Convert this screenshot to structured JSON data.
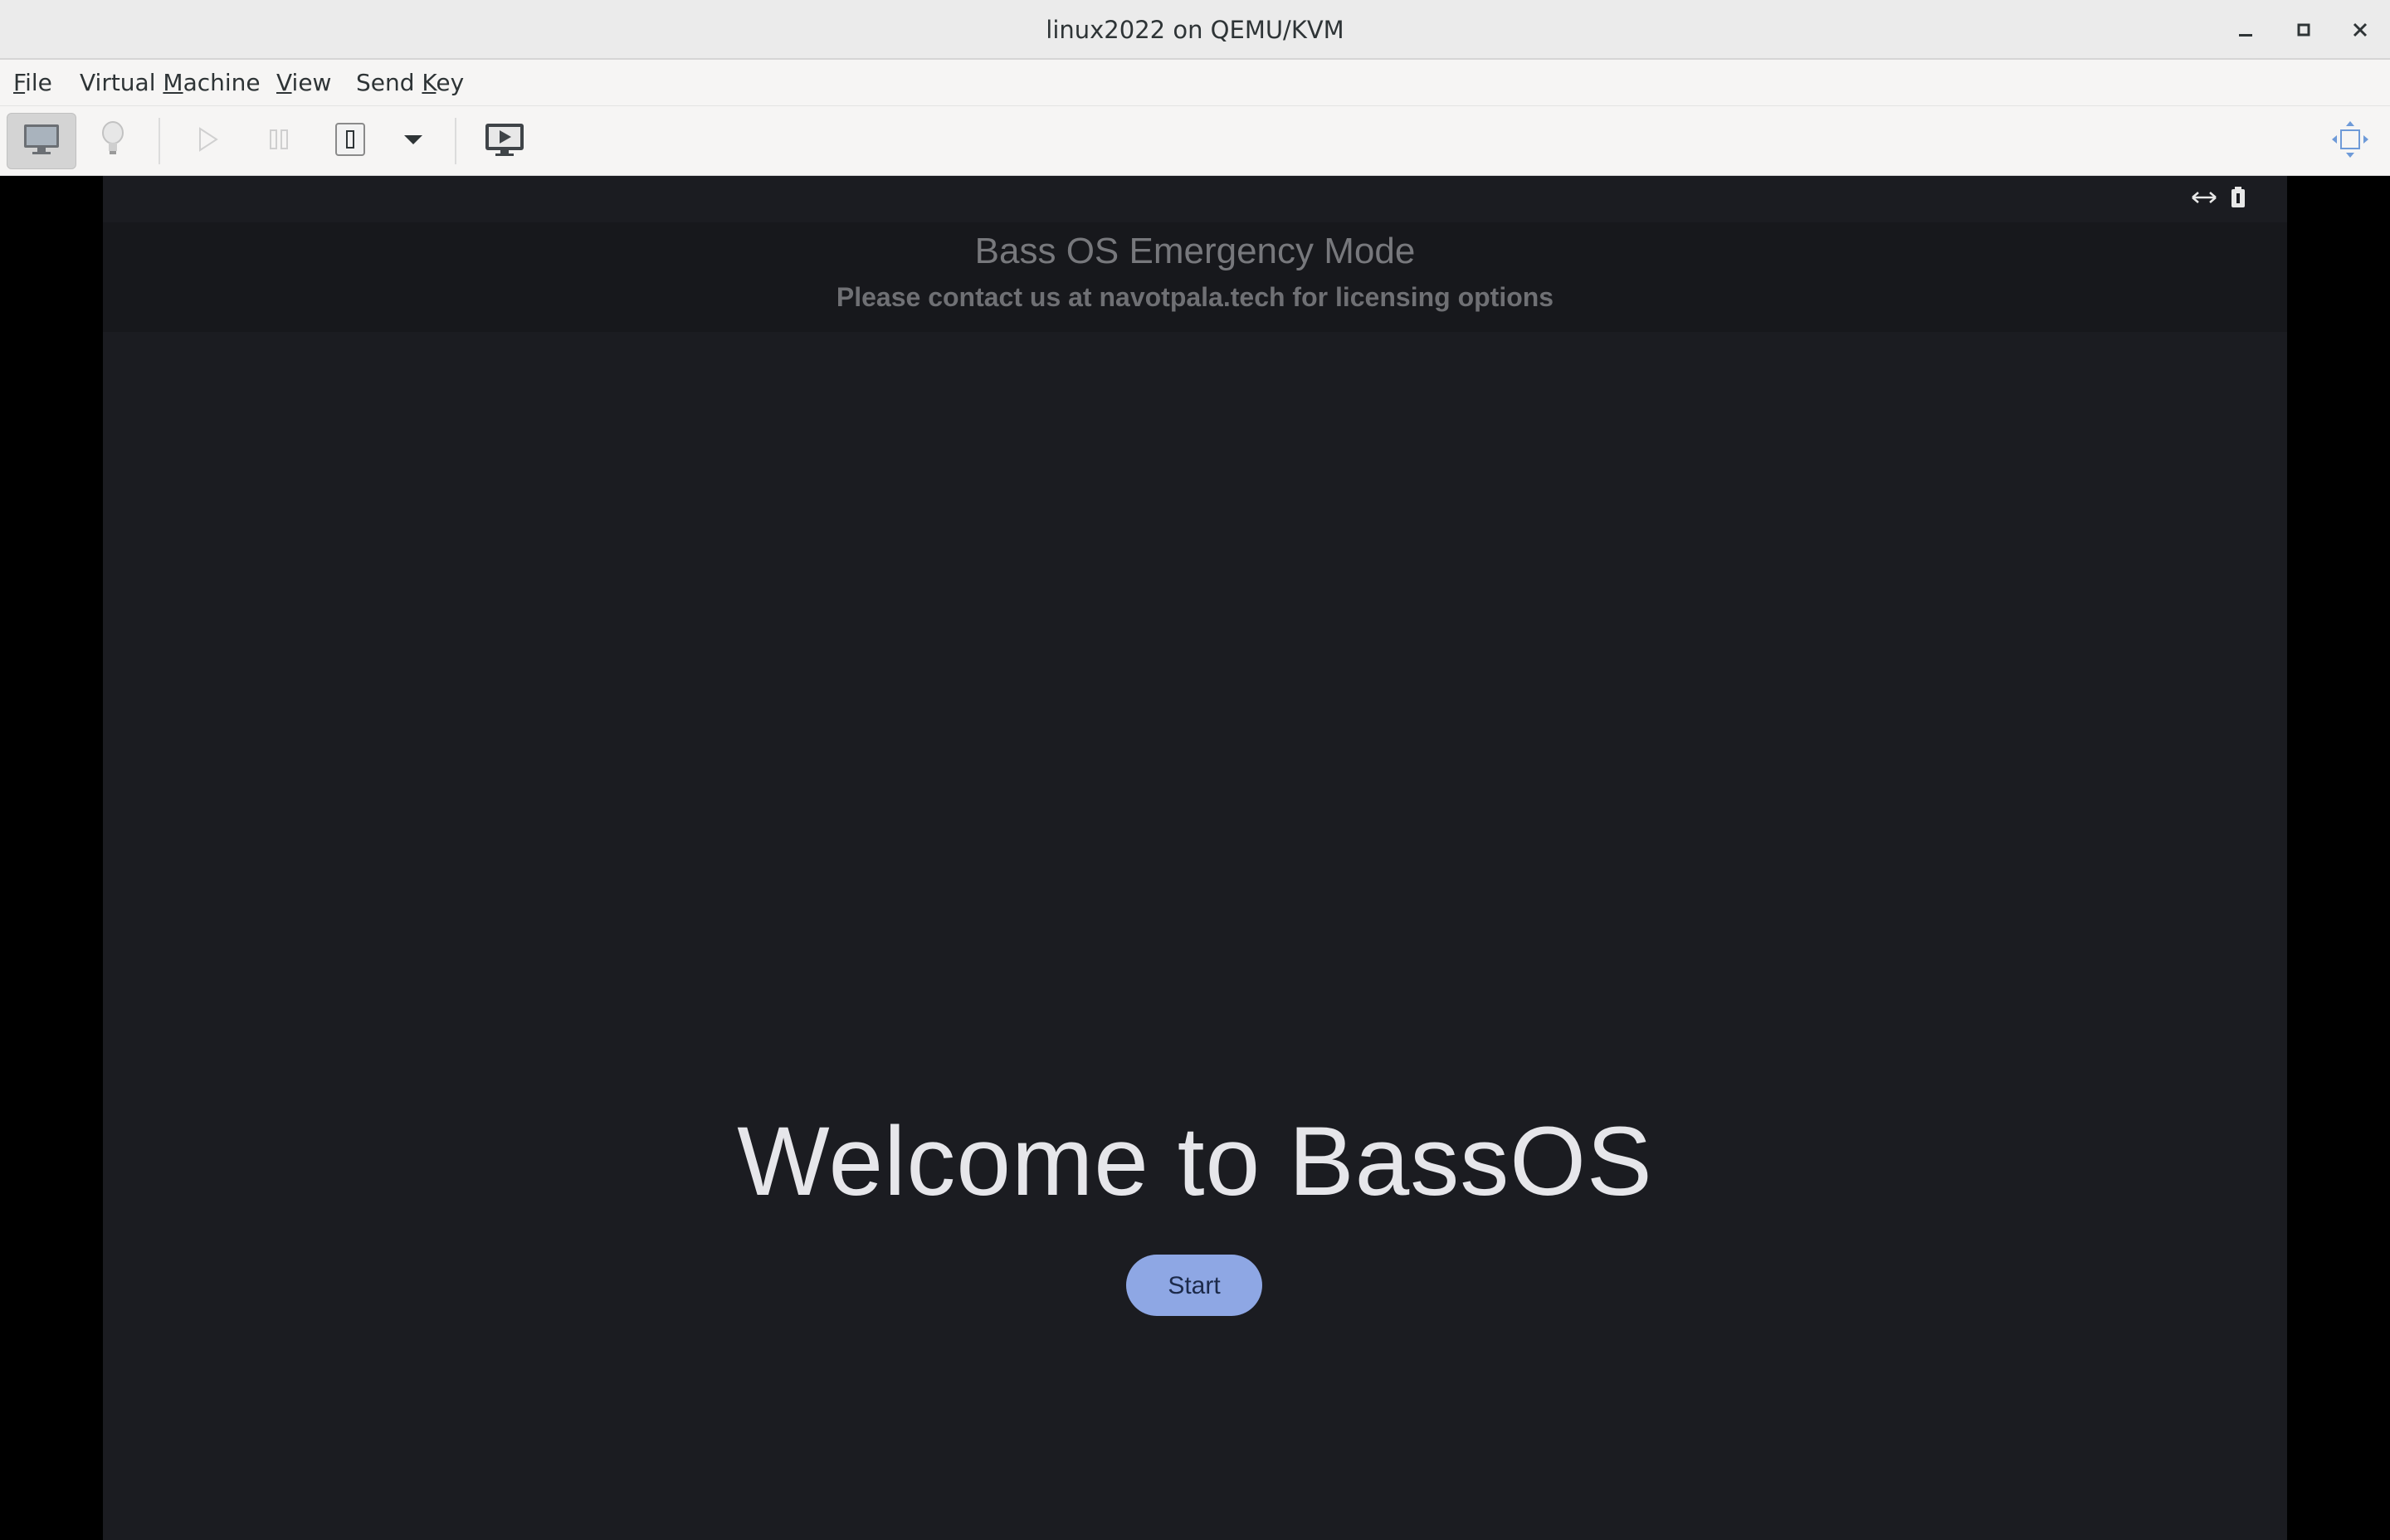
{
  "window": {
    "title": "linux2022 on QEMU/KVM"
  },
  "menubar": {
    "items": [
      {
        "label": "File",
        "mnemonic": "F"
      },
      {
        "label": "Virtual Machine",
        "mnemonic": "M"
      },
      {
        "label": "View",
        "mnemonic": "V"
      },
      {
        "label": "Send Key",
        "mnemonic": "K"
      }
    ]
  },
  "toolbar": {
    "buttons": [
      {
        "icon": "monitor-icon",
        "name": "show-console"
      },
      {
        "icon": "lightbulb-icon",
        "name": "show-details"
      },
      {
        "icon": "play-icon",
        "name": "run"
      },
      {
        "icon": "pause-icon",
        "name": "pause"
      },
      {
        "icon": "power-icon",
        "name": "shutdown"
      },
      {
        "icon": "chevron-down-icon",
        "name": "shutdown-menu"
      },
      {
        "icon": "snapshot-icon",
        "name": "snapshots"
      },
      {
        "icon": "fullscreen-icon",
        "name": "fullscreen"
      }
    ]
  },
  "guest": {
    "status_icons": [
      "resize-icon",
      "battery-icon"
    ],
    "banner_title": "Bass OS Emergency Mode",
    "banner_subtitle": "Please contact us at navotpala.tech for licensing options",
    "welcome": "Welcome to BassOS",
    "start_label": "Start"
  },
  "colors": {
    "guest_bg": "#1b1c21",
    "banner_bg": "#17181c",
    "start_button": "#8ea7e4"
  }
}
